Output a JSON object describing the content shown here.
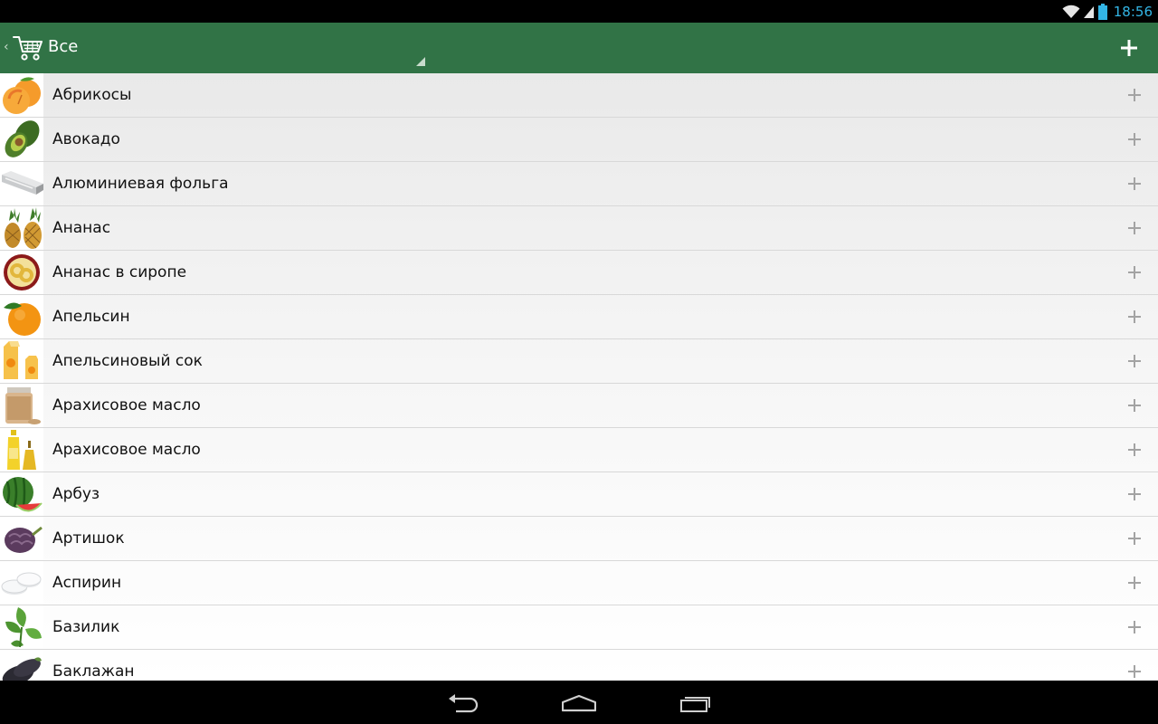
{
  "status_bar": {
    "time": "18:56"
  },
  "action_bar": {
    "title": "Все",
    "add_label": "+"
  },
  "colors": {
    "action_bar": "#317346",
    "status_time": "#33b5e5",
    "list_bg_top": "#e9e9e9",
    "list_bg_bottom": "#ffffff"
  },
  "items": [
    {
      "label": "Абрикосы",
      "icon": "apricot-icon"
    },
    {
      "label": "Авокадо",
      "icon": "avocado-icon"
    },
    {
      "label": "Алюминиевая фольга",
      "icon": "foil-icon"
    },
    {
      "label": "Ананас",
      "icon": "pineapple-icon"
    },
    {
      "label": "Ананас в сиропе",
      "icon": "canned-pineapple-icon"
    },
    {
      "label": "Апельсин",
      "icon": "orange-icon"
    },
    {
      "label": "Апельсиновый сок",
      "icon": "orange-juice-icon"
    },
    {
      "label": "Арахисовое масло",
      "icon": "peanut-butter-icon"
    },
    {
      "label": "Арахисовое масло",
      "icon": "peanut-oil-icon"
    },
    {
      "label": "Арбуз",
      "icon": "watermelon-icon"
    },
    {
      "label": "Артишок",
      "icon": "artichoke-icon"
    },
    {
      "label": "Аспирин",
      "icon": "aspirin-icon"
    },
    {
      "label": "Базилик",
      "icon": "basil-icon"
    },
    {
      "label": "Баклажан",
      "icon": "eggplant-icon"
    }
  ]
}
